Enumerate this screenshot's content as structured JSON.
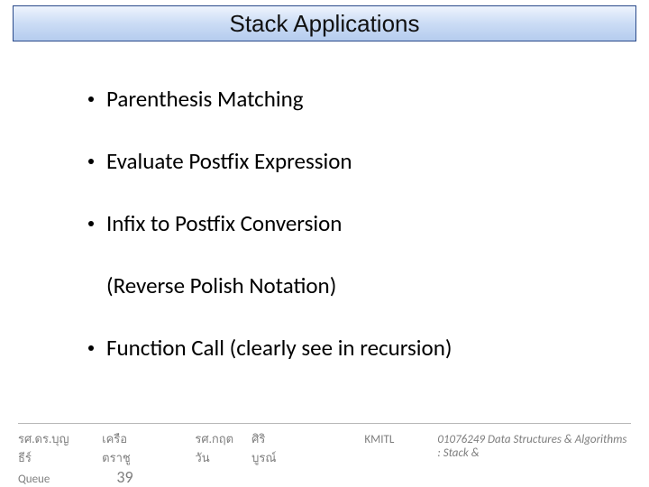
{
  "title": "Stack Applications",
  "bullets": [
    "Parenthesis Matching",
    "Evaluate Postfix Expression",
    "Infix to Postfix Conversion",
    "Function Call (clearly see in recursion)"
  ],
  "sub_note": "(Reverse Polish Notation)",
  "footer": {
    "name1": "รศ.ดร.บุญธีร์",
    "name2": "เครือตราชู",
    "name3": "รศ.กฤตวัน",
    "name4": "ศิริบูรณ์",
    "institution": "KMITL",
    "course": "01076249 Data Structures & Algorithms : Stack &",
    "queue": "Queue",
    "page": "39"
  }
}
